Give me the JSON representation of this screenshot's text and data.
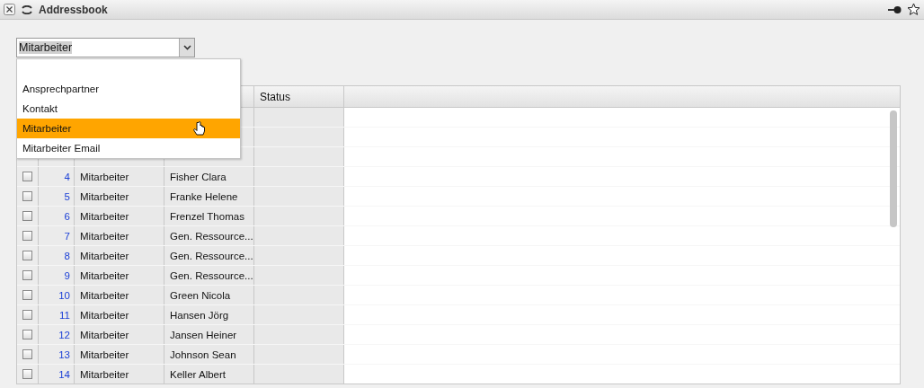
{
  "window": {
    "title": "Addressbook"
  },
  "combo": {
    "value": "Mitarbeiter"
  },
  "dropdown": {
    "items": [
      {
        "label": "Ansprechpartner",
        "selected": false
      },
      {
        "label": "Kontakt",
        "selected": false
      },
      {
        "label": "Mitarbeiter",
        "selected": true
      },
      {
        "label": "Mitarbeiter Email",
        "selected": false
      }
    ]
  },
  "table": {
    "columns": [
      {
        "label": "Status"
      }
    ],
    "rows": [
      {
        "checked": false,
        "number": "4",
        "type": "Mitarbeiter",
        "name": "Fisher Clara"
      },
      {
        "checked": false,
        "number": "5",
        "type": "Mitarbeiter",
        "name": "Franke Helene"
      },
      {
        "checked": false,
        "number": "6",
        "type": "Mitarbeiter",
        "name": "Frenzel Thomas"
      },
      {
        "checked": false,
        "number": "7",
        "type": "Mitarbeiter",
        "name": "Gen. Ressource..."
      },
      {
        "checked": false,
        "number": "8",
        "type": "Mitarbeiter",
        "name": "Gen. Ressource..."
      },
      {
        "checked": false,
        "number": "9",
        "type": "Mitarbeiter",
        "name": "Gen. Ressource..."
      },
      {
        "checked": false,
        "number": "10",
        "type": "Mitarbeiter",
        "name": "Green Nicola"
      },
      {
        "checked": false,
        "number": "11",
        "type": "Mitarbeiter",
        "name": "Hansen Jörg"
      },
      {
        "checked": false,
        "number": "12",
        "type": "Mitarbeiter",
        "name": "Jansen Heiner"
      },
      {
        "checked": false,
        "number": "13",
        "type": "Mitarbeiter",
        "name": "Johnson Sean"
      },
      {
        "checked": false,
        "number": "14",
        "type": "Mitarbeiter",
        "name": "Keller Albert"
      }
    ]
  }
}
